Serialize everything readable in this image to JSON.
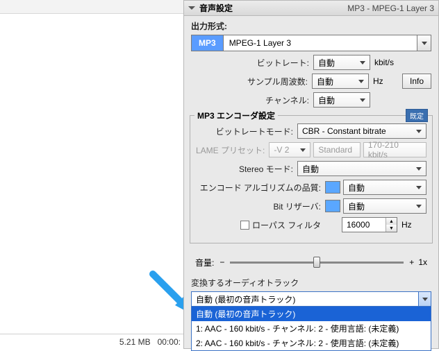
{
  "header": {
    "title": "音声設定",
    "sub": "MP3 - MPEG-1 Layer 3"
  },
  "output": {
    "section_label": "出力形式:",
    "badge": "MP3",
    "desc": "MPEG-1 Layer 3",
    "bitrate_label": "ビットレート:",
    "bitrate_value": "自動",
    "bitrate_unit": "kbit/s",
    "samplerate_label": "サンプル周波数:",
    "samplerate_value": "自動",
    "samplerate_unit": "Hz",
    "info_btn": "Info",
    "channel_label": "チャンネル:",
    "channel_value": "自動"
  },
  "encoder": {
    "legend": "MP3 エンコーダ設定",
    "badge": "既定",
    "bitrate_mode_label": "ビットレートモード:",
    "bitrate_mode_value": "CBR - Constant bitrate",
    "lame_label": "LAME プリセット:",
    "lame_v": "-V 2",
    "lame_std": "Standard",
    "lame_rate": "170-210 kbit/s",
    "stereo_label": "Stereo モード:",
    "stereo_value": "自動",
    "quality_label": "エンコード アルゴリズムの品質:",
    "quality_value": "自動",
    "reservoir_label": "Bit リザーバ:",
    "reservoir_value": "自動",
    "lowpass_label": "ローパス フィルタ",
    "lowpass_value": "16000",
    "lowpass_unit": "Hz"
  },
  "volume": {
    "label": "音量:",
    "minus": "−",
    "plus": "+",
    "value_text": "1x",
    "pos_pct": 50
  },
  "tracks": {
    "label": "変換するオーディオトラック",
    "selected": "自動 (最初の音声トラック)",
    "options": [
      "自動 (最初の音声トラック)",
      "1: AAC - 160 kbit/s - チャンネル: 2 - 使用言語: (未定義)",
      "2: AAC - 160 kbit/s - チャンネル: 2 - 使用言語: (未定義)"
    ]
  },
  "left_status": {
    "size": "5.21 MB",
    "time": "00:00:"
  }
}
